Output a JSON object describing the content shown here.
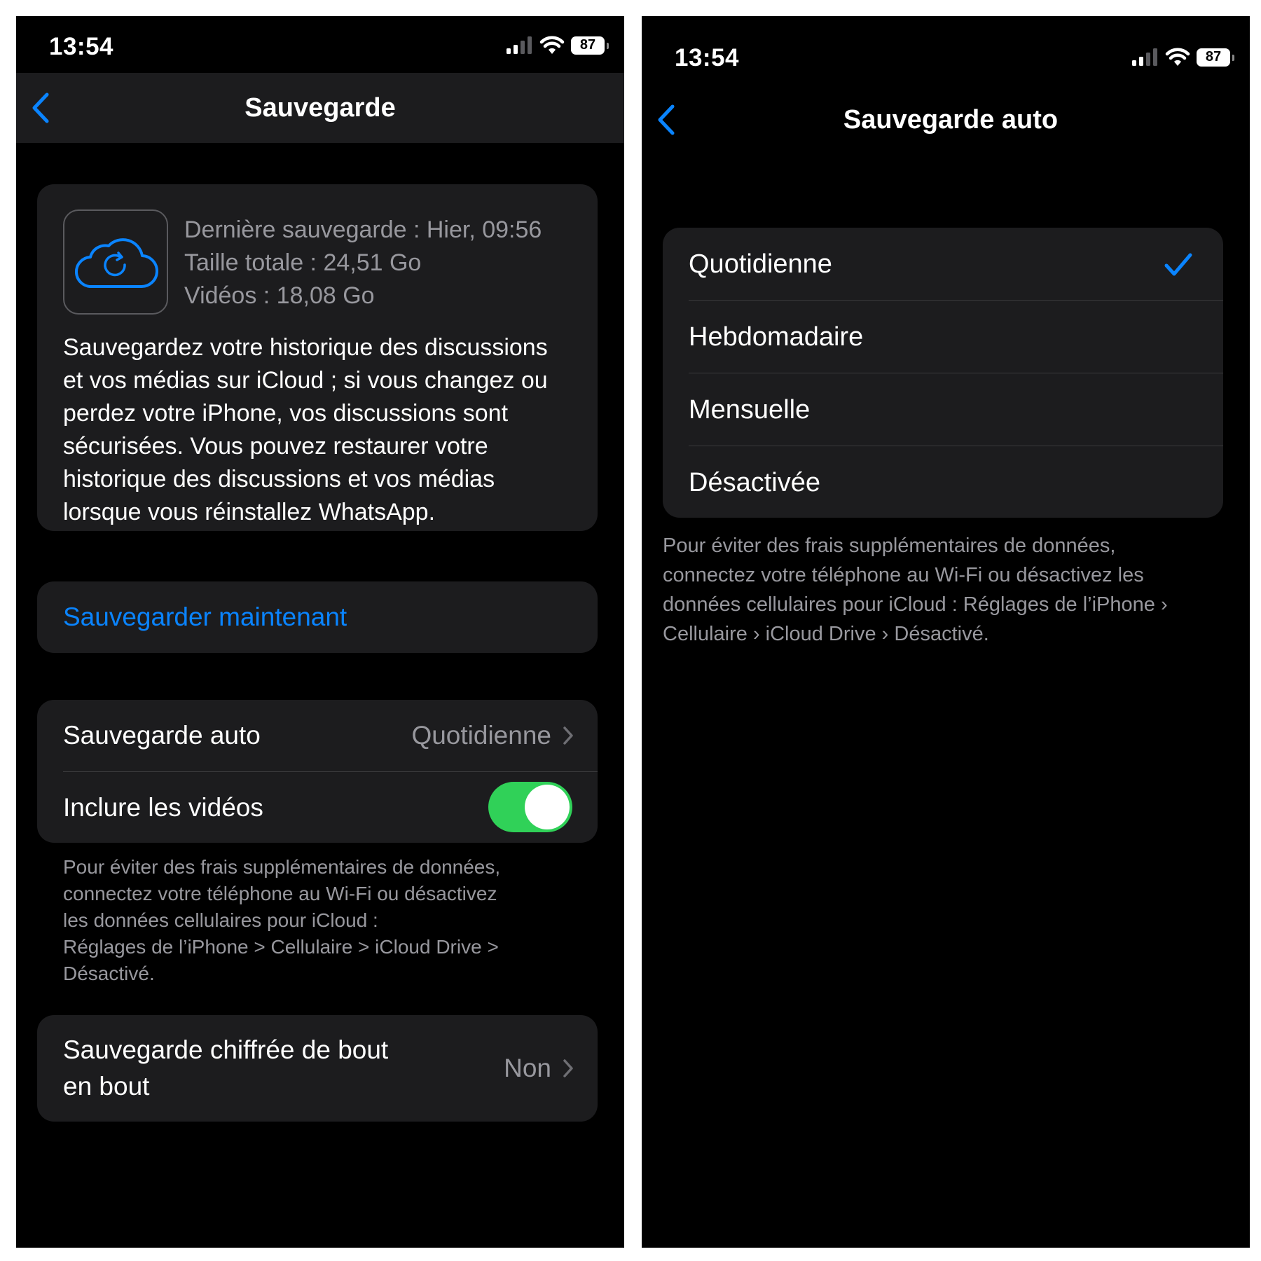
{
  "left": {
    "status": {
      "time": "13:54",
      "battery": "87"
    },
    "nav": {
      "title": "Sauvegarde"
    },
    "backup_info": {
      "icon": "cloud-sync-icon",
      "last_backup": "Dernière sauvegarde : Hier, 09:56",
      "total_size": "Taille totale : 24,51 Go",
      "videos_size": "Vidéos : 18,08 Go",
      "description": "Sauvegardez votre historique des discussions et vos médias sur iCloud ; si vous changez ou perdez votre iPhone, vos discussions sont sécurisées. Vous pouvez restaurer votre historique des discussions et vos médias lorsque vous réinstallez WhatsApp."
    },
    "backup_now": "Sauvegarder maintenant",
    "auto_backup": {
      "label": "Sauvegarde auto",
      "value": "Quotidienne"
    },
    "include_videos": {
      "label": "Inclure les vidéos",
      "on": true
    },
    "footnote_lines": [
      "Pour éviter des frais supplémentaires de données,",
      "connectez votre téléphone au Wi-Fi ou désactivez",
      "les données cellulaires pour iCloud :",
      "Réglages de l’iPhone > Cellulaire > iCloud Drive >",
      "Désactivé."
    ],
    "encrypted": {
      "label_line1": "Sauvegarde chiffrée de bout",
      "label_line2": "en bout",
      "value": "Non"
    }
  },
  "right": {
    "status": {
      "time": "13:54",
      "battery": "87"
    },
    "nav": {
      "title": "Sauvegarde auto"
    },
    "options": [
      "Quotidienne",
      "Hebdomadaire",
      "Mensuelle",
      "Désactivée"
    ],
    "selected": "Quotidienne",
    "footnote_lines": [
      "Pour éviter des frais supplémentaires de données,",
      "connectez votre téléphone au Wi-Fi ou désactivez les",
      "données cellulaires pour iCloud : Réglages de l’iPhone ›",
      "Cellulaire › iCloud Drive › Désactivé."
    ]
  },
  "colors": {
    "accent": "#0a84ff",
    "toggle_on": "#30d158",
    "card": "#1c1c1e",
    "secondary_text": "#98989e"
  }
}
